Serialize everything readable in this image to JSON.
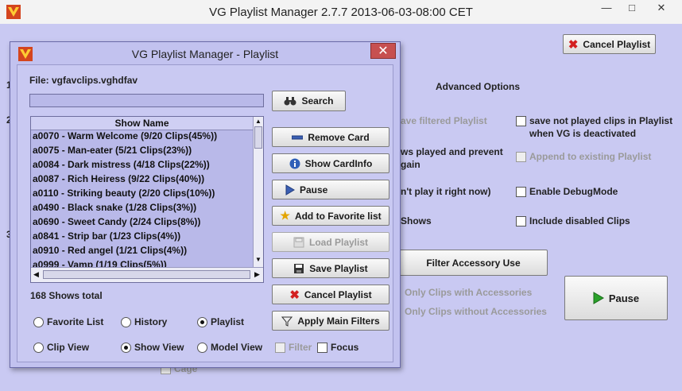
{
  "main": {
    "title": "VG Playlist Manager 2.7.7 2013-06-03-08:00 CET",
    "window_buttons": [
      "—",
      "□",
      "✕"
    ],
    "cancel_playlist": "Cancel Playlist",
    "advanced_options": "Advanced Options",
    "peek_filtered": "ave filtered Playlist",
    "peek_shows_played": "ws played and prevent",
    "peek_again": "gain",
    "peek_play_now": "n't play it right now)",
    "peek_shows": "Shows",
    "save_not_played": "save not played clips in Playlist",
    "save_not_played_2": "when VG is deactivated",
    "append_existing": "Append to existing Playlist",
    "enable_debug": "Enable DebugMode",
    "include_disabled": "Include disabled Clips",
    "filter_accessory": "Filter Accessory Use",
    "only_with_acc": "Only Clips with Accessories",
    "only_without_acc": "Only Clips without Accessories",
    "pause": "Pause",
    "cage": "Cage",
    "left_num_1": "1",
    "left_num_2": "2",
    "left_num_3": "3"
  },
  "dialog": {
    "title": "VG Playlist Manager - Playlist",
    "close": "✕",
    "file_label": "File: vgfavclips.vghdfav",
    "search_value": "",
    "search_button": "Search",
    "list_header": "Show Name",
    "rows": [
      "a0070 - Warm Welcome (9/20 Clips(45%))",
      "a0075 - Man-eater (5/21 Clips(23%))",
      "a0084 - Dark mistress (4/18 Clips(22%))",
      "a0087 - Rich Heiress (9/22 Clips(40%))",
      "a0110 - Striking beauty (2/20 Clips(10%))",
      "a0490 - Black snake (1/28 Clips(3%))",
      "a0690 - Sweet Candy (2/24 Clips(8%))",
      "a0841 - Strip bar (1/23 Clips(4%))",
      "a0910 - Red angel (1/21 Clips(4%))",
      "a0999 - Vamp (1/19 Clips(5%))"
    ],
    "shows_total": "168 Shows total",
    "buttons": {
      "remove_card": "Remove Card",
      "show_cardinfo": "Show CardInfo",
      "pause": "Pause",
      "add_favorite": "Add to Favorite list",
      "load_playlist": "Load Playlist",
      "save_playlist": "Save Playlist",
      "cancel_playlist": "Cancel Playlist",
      "apply_filters": "Apply Main Filters"
    },
    "radios_row1": [
      "Favorite List",
      "History",
      "Playlist"
    ],
    "radios_row2": [
      "Clip View",
      "Show View",
      "Model View"
    ],
    "filter": "Filter",
    "focus": "Focus"
  },
  "colors": {
    "background": "#c9c9f2",
    "close_red": "#c75050",
    "cancel_red": "#d32020",
    "play_green": "#2aa12a",
    "selection": "#b9b9e9"
  },
  "icons": [
    "app-logo-icon",
    "binoculars-icon",
    "minus-icon",
    "info-icon",
    "play-icon",
    "add-star-icon",
    "load-icon",
    "floppy-icon",
    "x-icon",
    "filter-icon"
  ]
}
